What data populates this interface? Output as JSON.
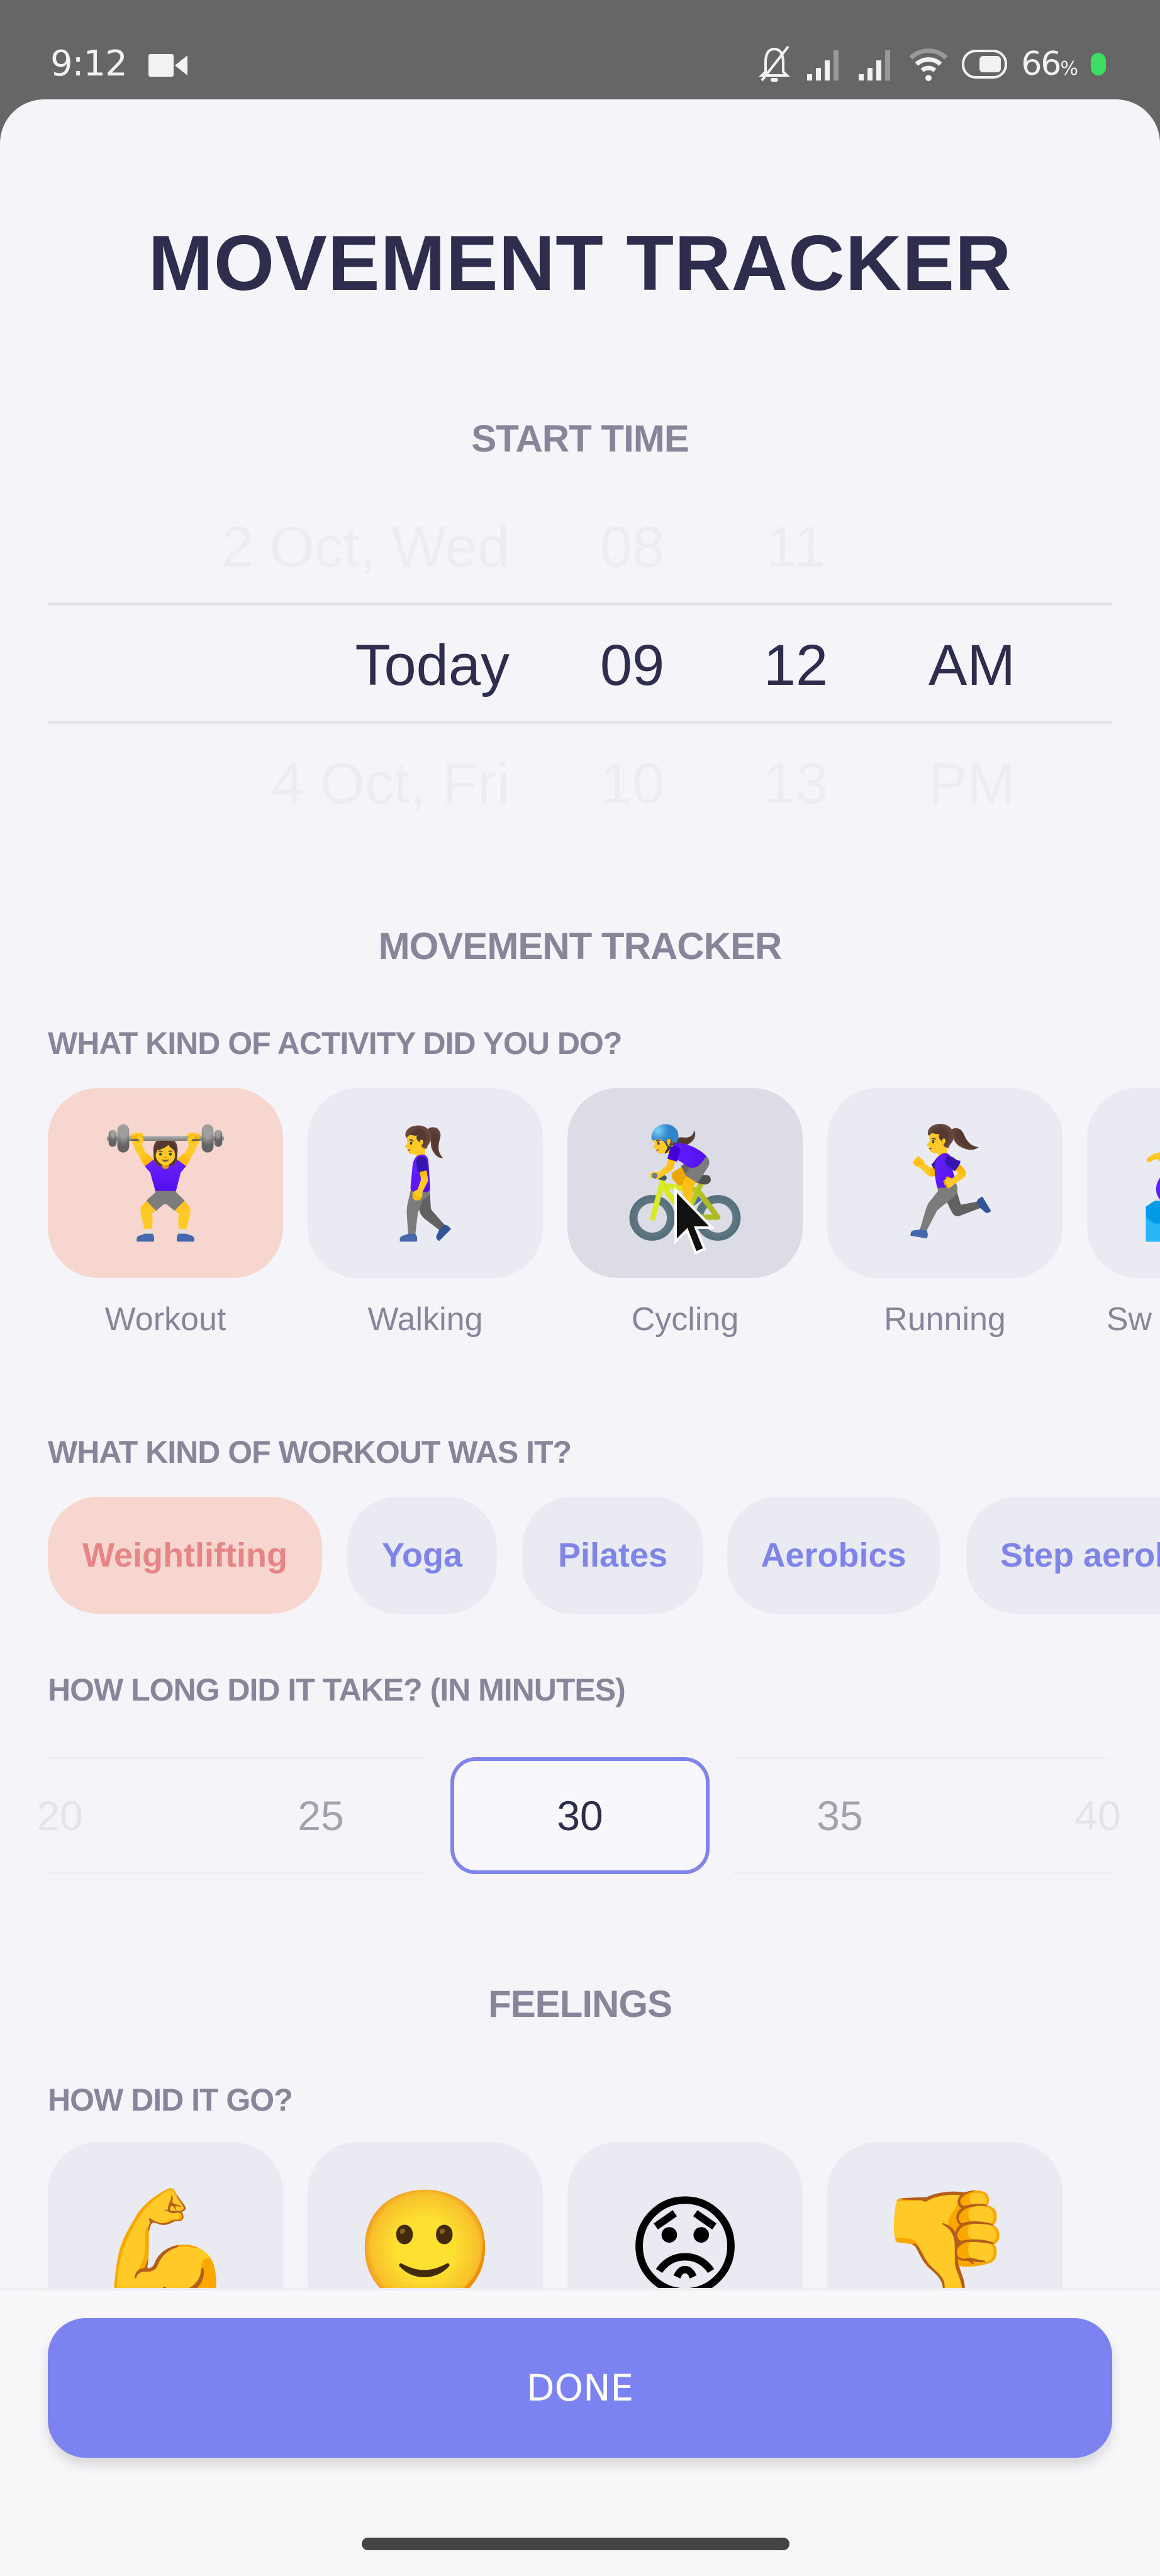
{
  "status_bar": {
    "time": "9:12",
    "battery_percent": "66",
    "battery_suffix": "%",
    "icons": [
      "video-camera-icon",
      "bell-off-icon",
      "signal-icon",
      "signal-icon",
      "wifi-icon",
      "battery-icon",
      "privacy-dot"
    ]
  },
  "header": {
    "title": "MOVEMENT TRACKER"
  },
  "start_time": {
    "label": "START TIME",
    "previous": {
      "date": "2 Oct, Wed",
      "hour": "08",
      "minute": "11",
      "ampm": ""
    },
    "selected": {
      "date": "Today",
      "hour": "09",
      "minute": "12",
      "ampm": "AM"
    },
    "next": {
      "date": "4 Oct, Fri",
      "hour": "10",
      "minute": "13",
      "ampm": "PM"
    }
  },
  "movement": {
    "section_title": "MOVEMENT TRACKER",
    "activity_question": "WHAT KIND OF ACTIVITY DID YOU DO?",
    "activities": [
      {
        "label": "Workout",
        "emoji": "🏋️‍♀️",
        "icon": "weightlifting-woman-icon",
        "selected": true
      },
      {
        "label": "Walking",
        "emoji": "🚶‍♀️",
        "icon": "walking-woman-icon",
        "selected": false
      },
      {
        "label": "Cycling",
        "emoji": "🚴‍♀️",
        "icon": "cycling-woman-icon",
        "selected": false
      },
      {
        "label": "Running",
        "emoji": "🏃‍♀️",
        "icon": "running-woman-icon",
        "selected": false
      },
      {
        "label": "Sw",
        "emoji": "🏊‍♀️",
        "icon": "swimming-woman-icon",
        "selected": false
      }
    ],
    "workout_question": "WHAT KIND OF WORKOUT WAS IT?",
    "workout_types": [
      {
        "label": "Weightlifting",
        "selected": true
      },
      {
        "label": "Yoga",
        "selected": false
      },
      {
        "label": "Pilates",
        "selected": false
      },
      {
        "label": "Aerobics",
        "selected": false
      },
      {
        "label": "Step aerobics",
        "selected": false
      }
    ],
    "duration_question": "HOW LONG DID IT TAKE? (IN MINUTES)",
    "duration_options": [
      "20",
      "25",
      "30",
      "35",
      "40"
    ],
    "duration_selected": "30"
  },
  "feelings": {
    "section_title": "FEELINGS",
    "question": "HOW DID IT GO?",
    "options": [
      {
        "emoji": "💪",
        "icon": "flexed-biceps-icon"
      },
      {
        "emoji": "🙂",
        "icon": "slightly-smiling-face-icon"
      },
      {
        "emoji": "😟",
        "icon": "worried-face-icon"
      },
      {
        "emoji": "👎",
        "icon": "thumbs-down-icon"
      }
    ]
  },
  "footer": {
    "done_label": "DONE"
  },
  "colors": {
    "accent": "#7B83F0",
    "selected_bg": "#F8D6D0",
    "selected_text": "#E58585",
    "title_text": "#2E2D4D",
    "label_text": "#86859A"
  }
}
